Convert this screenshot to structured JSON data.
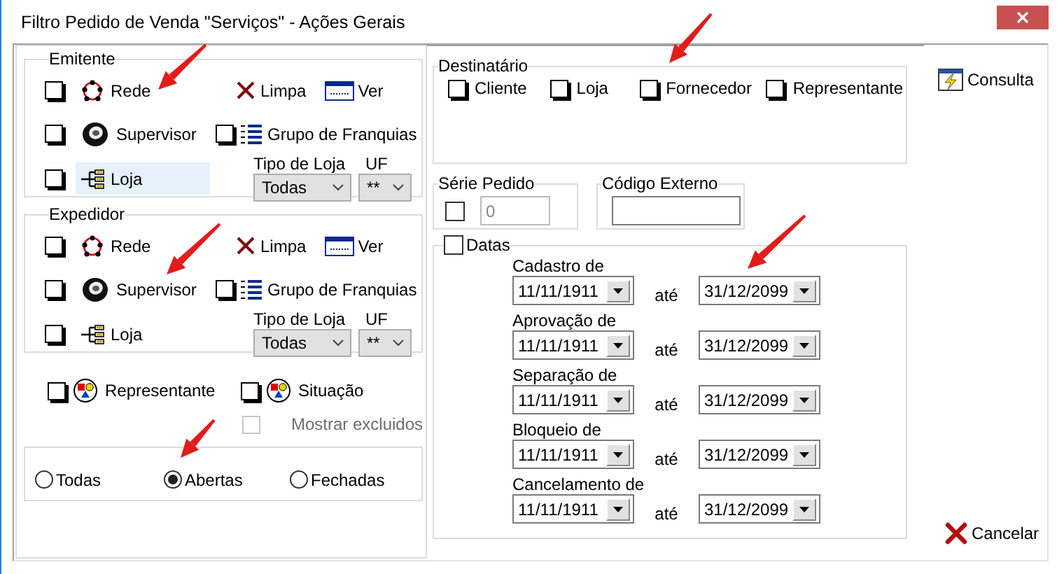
{
  "window": {
    "title": "Filtro Pedido de Venda \"Serviços\" - Ações Gerais"
  },
  "parties": [
    {
      "title": "Emitente",
      "options": [
        {
          "label": "Rede",
          "checked": false,
          "selected": false
        },
        {
          "label": "Supervisor",
          "checked": false,
          "selected": false
        },
        {
          "label": "Loja",
          "checked": false,
          "selected": true
        }
      ],
      "actions": [
        "Limpa",
        "Ver"
      ],
      "group_check": {
        "label": "Grupo de Franquias",
        "checked": false
      },
      "store_type": {
        "label": "Tipo de Loja",
        "value": "Todas"
      },
      "uf": {
        "label": "UF",
        "value": "**"
      }
    },
    {
      "title": "Expedidor",
      "options": [
        {
          "label": "Rede",
          "checked": false,
          "selected": false
        },
        {
          "label": "Supervisor",
          "checked": false,
          "selected": false
        },
        {
          "label": "Loja",
          "checked": false,
          "selected": false
        }
      ],
      "actions": [
        "Limpa",
        "Ver"
      ],
      "group_check": {
        "label": "Grupo de Franquias",
        "checked": false
      },
      "store_type": {
        "label": "Tipo de Loja",
        "value": "Todas"
      },
      "uf": {
        "label": "UF",
        "value": "**"
      }
    }
  ],
  "extra_checks": [
    {
      "label": "Representante",
      "checked": false,
      "disabled": false
    },
    {
      "label": "Situação",
      "checked": false,
      "disabled": false
    },
    {
      "label": "Mostrar excluidos",
      "checked": false,
      "disabled": true
    }
  ],
  "status_radios": [
    {
      "label": "Todas",
      "selected": false
    },
    {
      "label": "Abertas",
      "selected": true
    },
    {
      "label": "Fechadas",
      "selected": false
    }
  ],
  "destinatario": {
    "title": "Destinatário",
    "options": [
      {
        "label": "Cliente",
        "checked": false
      },
      {
        "label": "Loja",
        "checked": false
      },
      {
        "label": "Fornecedor",
        "checked": false
      },
      {
        "label": "Representante",
        "checked": false
      }
    ]
  },
  "serie_pedido": {
    "title": "Série Pedido",
    "checked": false,
    "value": "0",
    "disabled": true
  },
  "codigo_externo": {
    "title": "Código Externo"
  },
  "datas": {
    "title": "Datas",
    "checked": false,
    "rows": [
      {
        "label": "Cadastro de",
        "from": "11/11/1911",
        "separator": "até",
        "to": "31/12/2099"
      },
      {
        "label": "Aprovação de",
        "from": "11/11/1911",
        "separator": "até",
        "to": "31/12/2099"
      },
      {
        "label": "Separação de",
        "from": "11/11/1911",
        "separator": "até",
        "to": "31/12/2099"
      },
      {
        "label": "Bloqueio de",
        "from": "11/11/1911",
        "separator": "até",
        "to": "31/12/2099"
      },
      {
        "label": "Cancelamento de",
        "from": "11/11/1911",
        "separator": "até",
        "to": "31/12/2099"
      }
    ]
  },
  "buttons": [
    {
      "label": "Consulta",
      "kind": "search"
    },
    {
      "label": "Cancelar",
      "kind": "cancel"
    }
  ]
}
